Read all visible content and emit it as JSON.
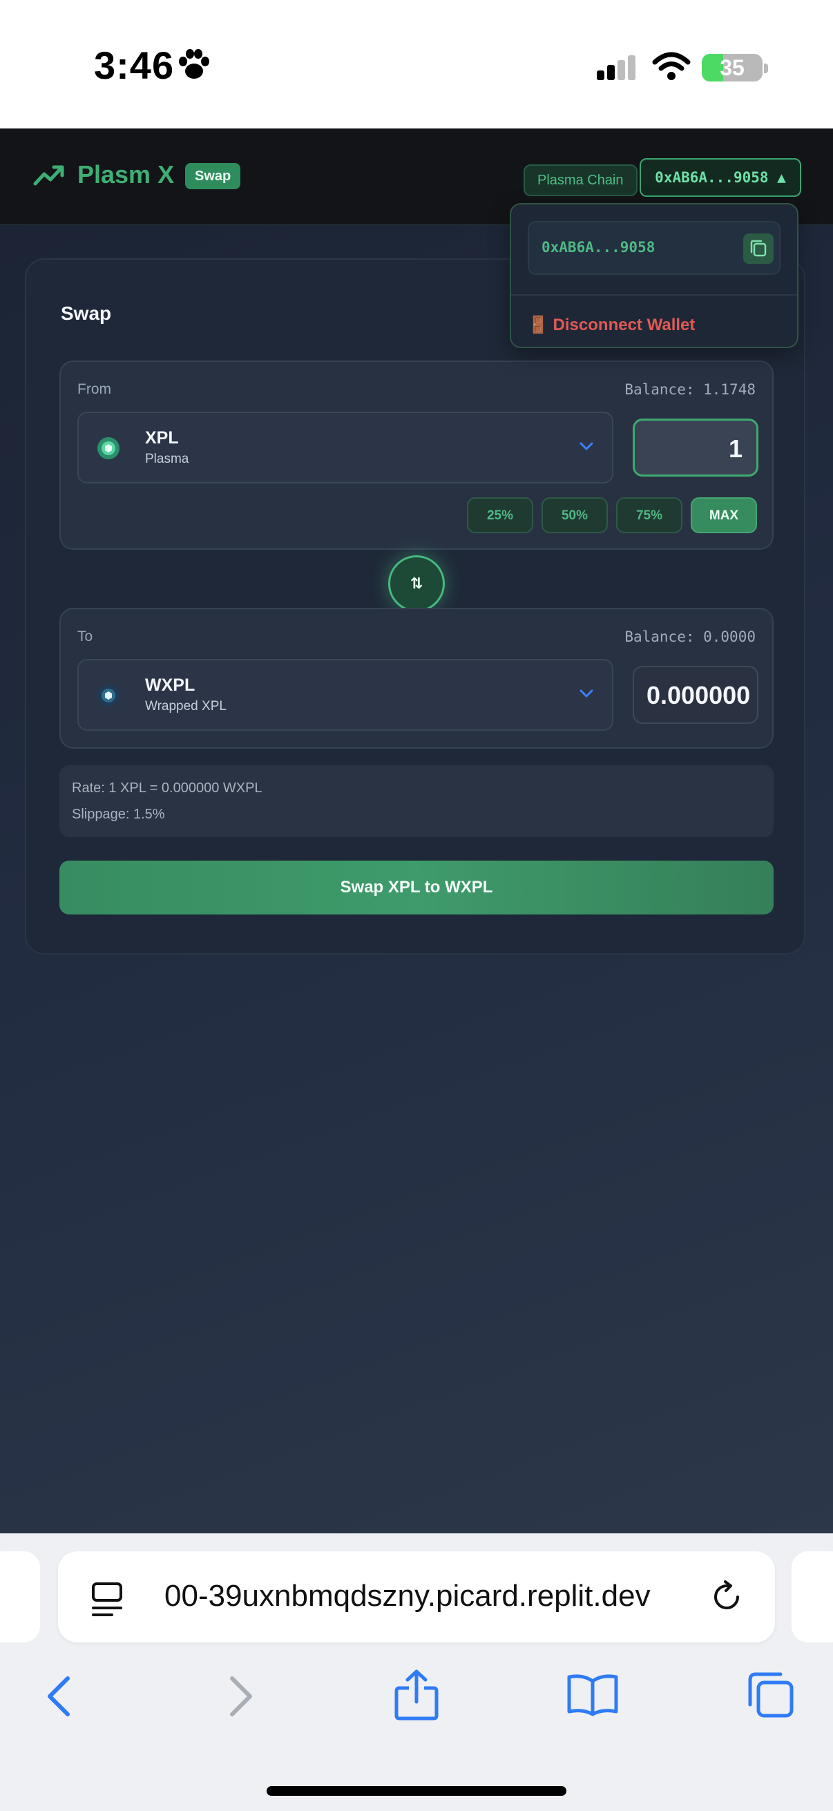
{
  "status": {
    "time": "3:46",
    "battery": "35",
    "battery_level": 0.35,
    "icons": [
      "paw-icon",
      "signal-icon",
      "wifi-icon",
      "battery-icon"
    ]
  },
  "app": {
    "brand": "Plasm X",
    "brand_badge": "Swap",
    "chain": "Plasma Chain",
    "wallet_chip": "0xAB6A...9058 ▲",
    "colors": {
      "accent": "#3fae74",
      "danger": "#e05a55",
      "background": "#1f2838"
    }
  },
  "dropdown": {
    "address": "0xAB6A...9058",
    "disconnect": "🚪 Disconnect Wallet"
  },
  "swap": {
    "title": "Swap",
    "from": {
      "label": "From",
      "balance": "Balance: 1.1748",
      "token": "XPL",
      "network": "Plasma",
      "amount": "1"
    },
    "percents": [
      "25%",
      "50%",
      "75%",
      "MAX"
    ],
    "flip_icon": "⇅",
    "to": {
      "label": "To",
      "balance": "Balance: 0.0000",
      "token": "WXPL",
      "network": "Wrapped XPL",
      "amount": "0.000000"
    },
    "rate": "Rate: 1 XPL = 0.000000 WXPL",
    "slippage": "Slippage: 1.5%",
    "button": "Swap XPL to WXPL"
  },
  "browser": {
    "url": "00-39uxnbmqdszny.picard.replit.dev"
  }
}
